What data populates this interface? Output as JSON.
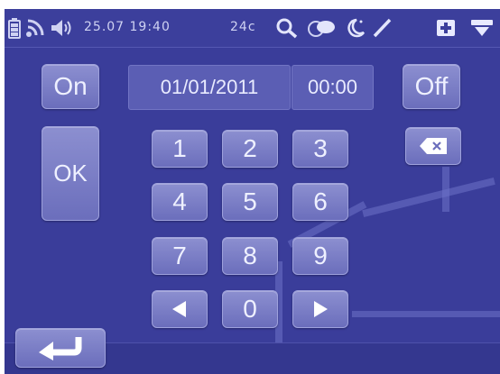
{
  "status": {
    "date_time": "25.07 19:40",
    "temperature": "24c",
    "icons": [
      "battery-icon",
      "signal-icon",
      "speaker-icon",
      "search-icon",
      "chat-icon",
      "moon-icon",
      "pen-icon",
      "plus-icon",
      "menu-icon"
    ]
  },
  "controls": {
    "on_label": "On",
    "off_label": "Off",
    "ok_label": "OK"
  },
  "fields": {
    "date": "01/01/2011",
    "time": "00:00"
  },
  "keypad": {
    "keys": [
      "1",
      "2",
      "3",
      "4",
      "5",
      "6",
      "7",
      "8",
      "9",
      "0"
    ],
    "left_icon": "arrow-left-icon",
    "right_icon": "arrow-right-icon",
    "backspace_icon": "backspace-icon"
  },
  "colors": {
    "screen_bg": "#3a3d9a",
    "button": "#7b7ec6",
    "text": "#eef0ff"
  }
}
